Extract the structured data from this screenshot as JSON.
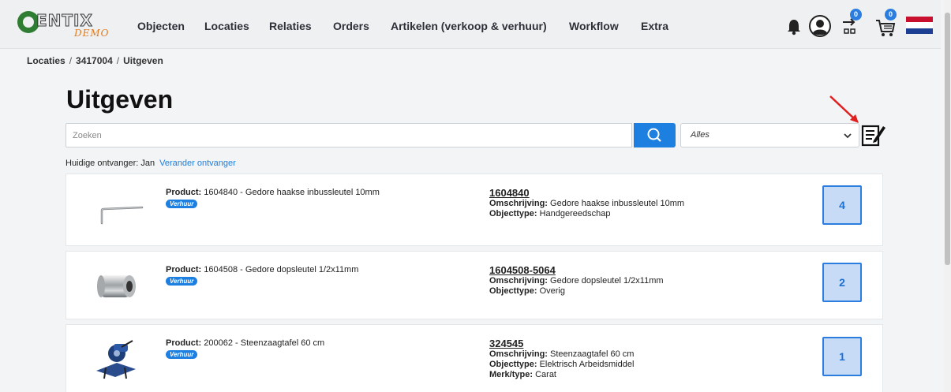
{
  "brand": {
    "logo_text": "ENTIX",
    "logo_sub": "DEMO"
  },
  "nav": {
    "items": [
      "Objecten",
      "Locaties",
      "Relaties",
      "Orders",
      "Artikelen (verkoop & verhuur)",
      "Workflow",
      "Extra"
    ],
    "transfer_badge": "0",
    "cart_badge": "0",
    "icons": [
      "bell-icon",
      "user-avatar-icon",
      "transfer-icon",
      "cart-icon",
      "flag-nl-icon"
    ]
  },
  "breadcrumb": {
    "items": [
      "Locaties",
      "3417004",
      "Uitgeven"
    ],
    "separator": "/"
  },
  "page": {
    "title": "Uitgeven"
  },
  "search": {
    "placeholder": "Zoeken",
    "value": ""
  },
  "filter": {
    "selected": "Alles"
  },
  "recipient": {
    "label": "Huidige ontvanger: Jan",
    "change_link": "Verander ontvanger"
  },
  "cards": [
    {
      "product_label": "Product:",
      "product_text": "1604840 - Gedore haakse inbussleutel 10mm",
      "tag": "Verhuur",
      "code": "1604840",
      "desc_label": "Omschrijving:",
      "desc": "Gedore haakse inbussleutel 10mm",
      "type_label": "Objecttype:",
      "type": "Handgereedschap",
      "brand_label": "",
      "brand": "",
      "qty": "4",
      "image": "allen-key"
    },
    {
      "product_label": "Product:",
      "product_text": "1604508 - Gedore dopsleutel 1/2x11mm",
      "tag": "Verhuur",
      "code": "1604508-5064",
      "desc_label": "Omschrijving:",
      "desc": "Gedore dopsleutel 1/2x11mm",
      "type_label": "Objecttype:",
      "type": "Overig",
      "brand_label": "",
      "brand": "",
      "qty": "2",
      "image": "socket"
    },
    {
      "product_label": "Product:",
      "product_text": "200062 - Steenzaagtafel 60 cm",
      "tag": "Verhuur",
      "code": "324545",
      "desc_label": "Omschrijving:",
      "desc": "Steenzaagtafel 60 cm",
      "type_label": "Objecttype:",
      "type": "Elektrisch Arbeidsmiddel",
      "brand_label": "Merk/type:",
      "brand": "Carat",
      "qty": "1",
      "image": "stone-saw"
    }
  ],
  "colors": {
    "accent": "#1d7fe0",
    "qty_bg": "#c7dbf7",
    "arrow": "#e02020"
  }
}
